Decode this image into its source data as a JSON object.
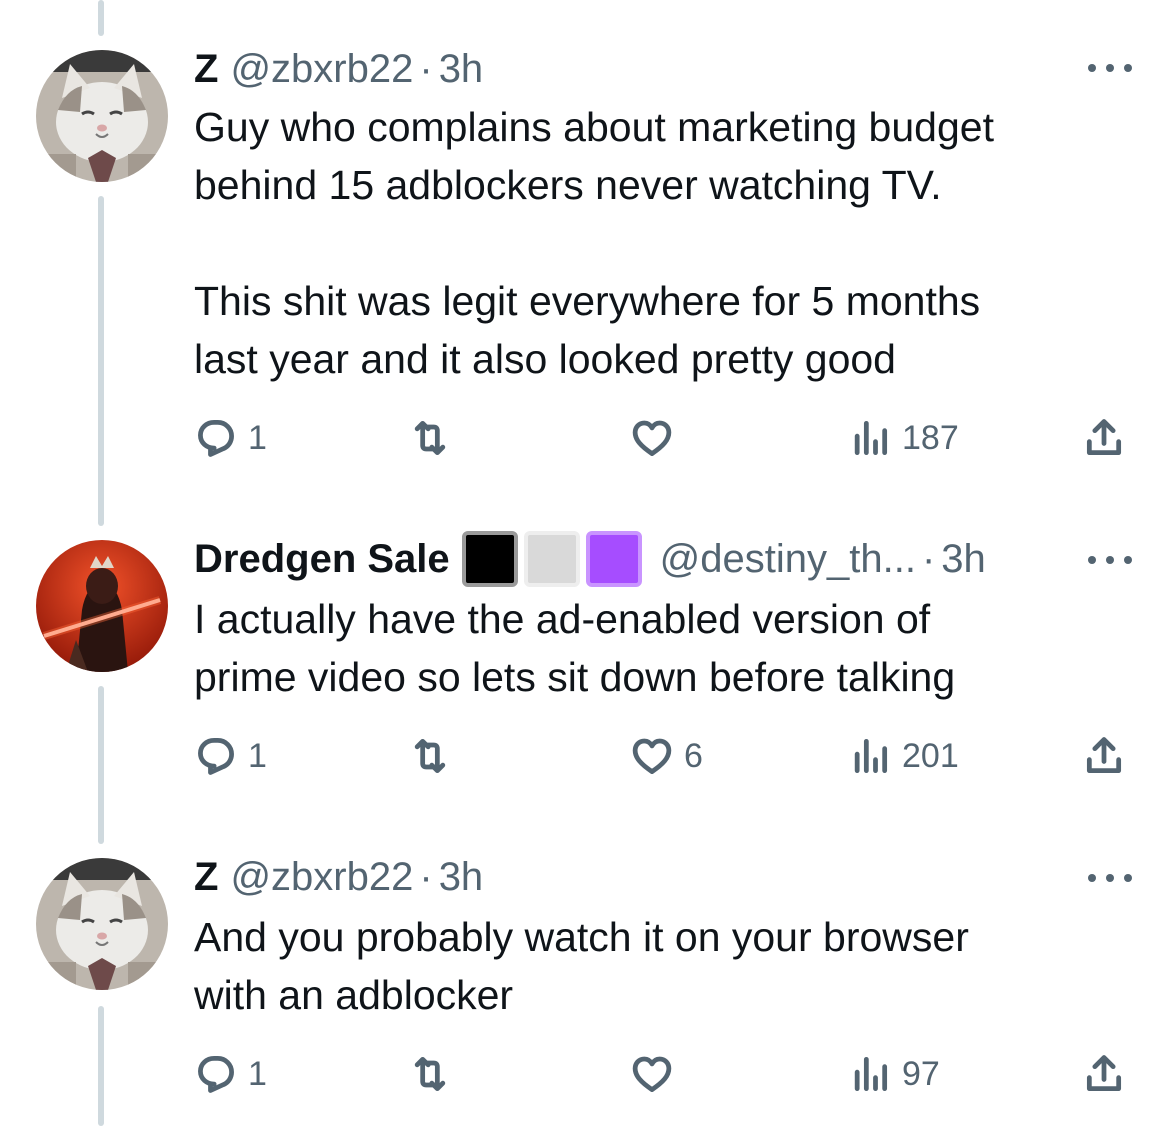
{
  "tweets": [
    {
      "name": "Z",
      "handle": "@zbxrb22",
      "dot": "·",
      "time": "3h",
      "text": "Guy who complains about marketing budget\nbehind 15 adblockers never watching TV.\n\nThis shit was legit everywhere for 5 months\nlast year and it also looked pretty good",
      "replies": "1",
      "retweets": "",
      "likes": "",
      "views": "187",
      "avatar": "cat-avatar"
    },
    {
      "name": "Dredgen Sale",
      "handle": "@destiny_th...",
      "dot": "·",
      "time": "3h",
      "text": "I actually have the ad-enabled version of\nprime video so lets sit down before talking",
      "replies": "1",
      "retweets": "",
      "likes": "6",
      "views": "201",
      "avatar": "red-warrior-avatar",
      "badges": [
        "#000000",
        "#d9d9d9",
        "#a64dff"
      ]
    },
    {
      "name": "Z",
      "handle": "@zbxrb22",
      "dot": "·",
      "time": "3h",
      "text": "And you probably watch it on your browser\nwith an adblocker",
      "replies": "1",
      "retweets": "",
      "likes": "",
      "views": "97",
      "avatar": "cat-avatar"
    }
  ],
  "icons": {
    "reply": "reply-icon",
    "retweet": "retweet-icon",
    "like": "heart-icon",
    "views": "views-icon",
    "share": "share-icon",
    "more": "more-icon"
  },
  "colors": {
    "text": "#0f1419",
    "secondary": "#536471",
    "thread_line": "#cfd9de"
  }
}
